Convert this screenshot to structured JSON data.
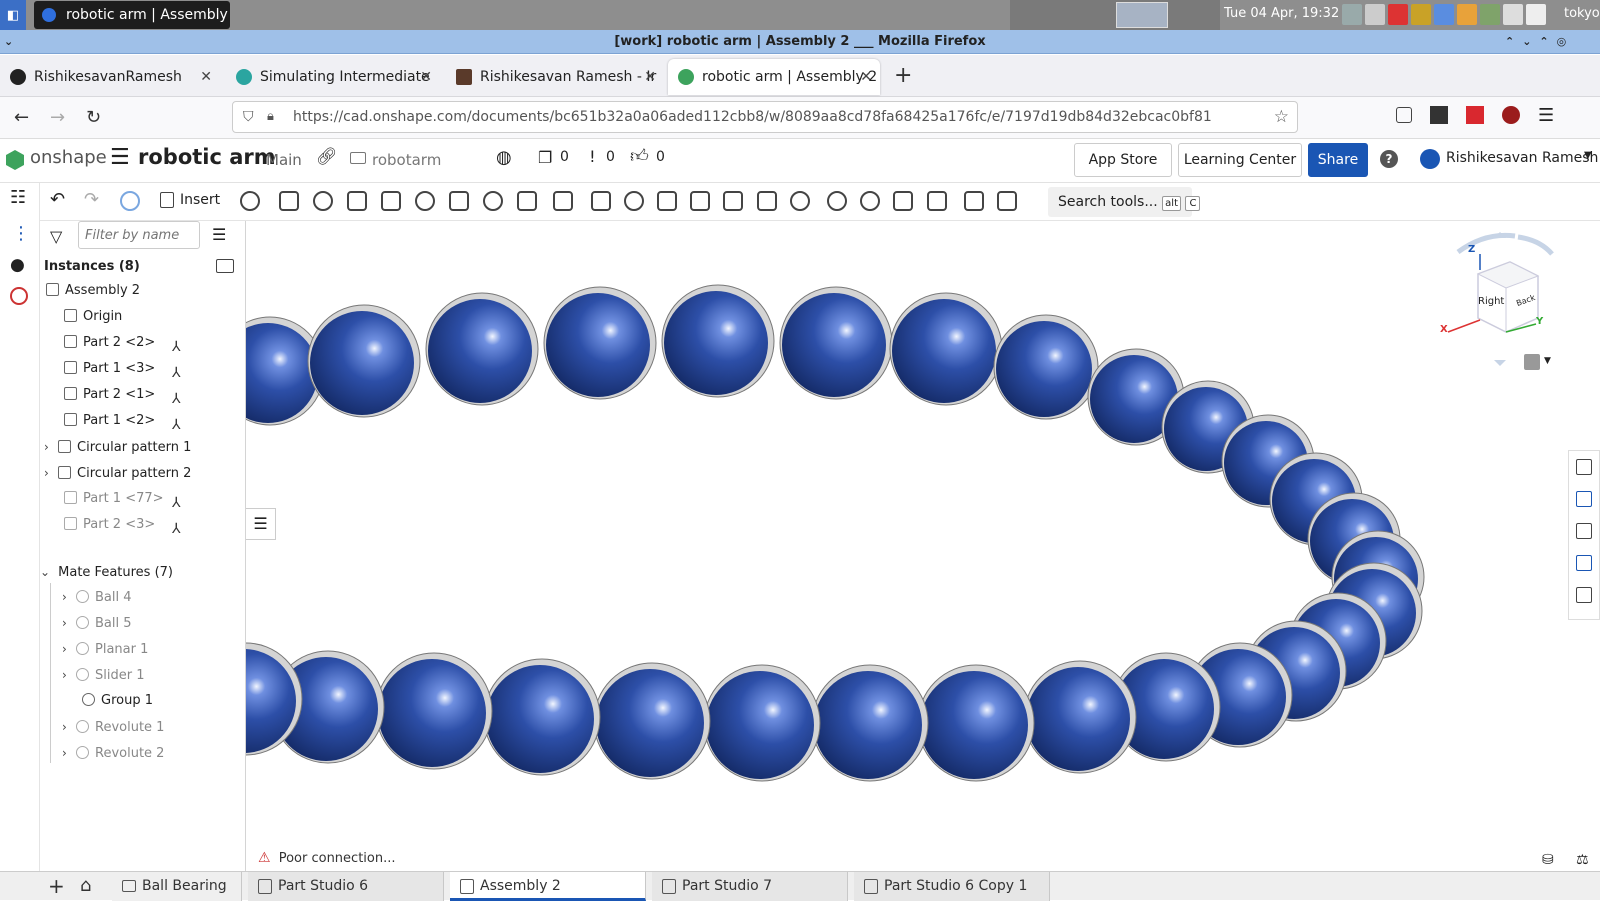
{
  "taskbar": {
    "window_title": "robotic arm | Assembly ...",
    "clock": "Tue 04 Apr, 19:32",
    "location": "tokyo"
  },
  "window": {
    "title": "[work] robotic arm | Assembly 2 ___ Mozilla Firefox"
  },
  "browser_tabs": [
    {
      "label": "RishikesavanRamesh",
      "color": "#222222"
    },
    {
      "label": "Simulating Intermediate",
      "color": "#2ba5a0"
    },
    {
      "label": "Rishikesavan Ramesh - Ir",
      "color": "#5a3a2a"
    },
    {
      "label": "robotic arm | Assembly 2",
      "color": "#3da35d"
    }
  ],
  "url": "https://cad.onshape.com/documents/bc651b32a0a06aded112cbb8/w/8089aa8cd78fa68425a176fc/e/7197d19db84d32ebcac0bf81",
  "header": {
    "logo": "onshape",
    "doc_title": "robotic arm",
    "branch": "Main",
    "folder": "robotarm",
    "versions_count": "0",
    "comments_count": "0",
    "likes_count": "0",
    "app_store": "App Store",
    "learning_center": "Learning Center",
    "share": "Share",
    "help": "?",
    "user": "Rishikesavan Ramesh"
  },
  "toolbar": {
    "insert": "Insert",
    "search_tools": "Search tools...",
    "shortcut_alt": "alt",
    "shortcut_c": "C"
  },
  "panel": {
    "filter_placeholder": "Filter by name",
    "instances_title": "Instances (8)",
    "items": [
      {
        "label": "Assembly 2",
        "level": 0,
        "dim": false,
        "chev": "",
        "mate": false
      },
      {
        "label": "Origin",
        "level": 1,
        "dim": false,
        "chev": "",
        "mate": false
      },
      {
        "label": "Part 2 <2>",
        "level": 1,
        "dim": false,
        "chev": "",
        "mate": true
      },
      {
        "label": "Part 1 <3>",
        "level": 1,
        "dim": false,
        "chev": "",
        "mate": true
      },
      {
        "label": "Part 2 <1>",
        "level": 1,
        "dim": false,
        "chev": "",
        "mate": true
      },
      {
        "label": "Part 1 <2>",
        "level": 1,
        "dim": false,
        "chev": "",
        "mate": true
      },
      {
        "label": "Circular pattern 1",
        "level": 0,
        "dim": false,
        "chev": "›",
        "mate": false
      },
      {
        "label": "Circular pattern 2",
        "level": 0,
        "dim": false,
        "chev": "›",
        "mate": false
      },
      {
        "label": "Part 1 <77>",
        "level": 1,
        "dim": true,
        "chev": "",
        "mate": true
      },
      {
        "label": "Part 2 <3>",
        "level": 1,
        "dim": true,
        "chev": "",
        "mate": true
      }
    ],
    "mate_features_title": "Mate Features (7)",
    "mates": [
      {
        "label": "Ball 4",
        "dim": true
      },
      {
        "label": "Ball 5",
        "dim": true
      },
      {
        "label": "Planar 1",
        "dim": true
      },
      {
        "label": "Slider 1",
        "dim": true
      },
      {
        "label": "Group 1",
        "dim": false
      },
      {
        "label": "Revolute 1",
        "dim": true
      },
      {
        "label": "Revolute 2",
        "dim": true
      }
    ]
  },
  "viewcube": {
    "front_label": "Right",
    "side_label": "Back",
    "axis_z": "Z",
    "axis_x": "X",
    "axis_y": "Y"
  },
  "status": {
    "poor_connection": "Poor connection..."
  },
  "bottom_tabs": [
    {
      "label": "Ball Bearing",
      "active": false
    },
    {
      "label": "Part Studio 6",
      "active": false
    },
    {
      "label": "Assembly 2",
      "active": true
    },
    {
      "label": "Part Studio 7",
      "active": false
    },
    {
      "label": "Part Studio 6 Copy 1",
      "active": false
    }
  ],
  "colors": {
    "accent": "#1a56b4",
    "sphere": "#2a4a9a",
    "ring": "#cfcfcf"
  }
}
